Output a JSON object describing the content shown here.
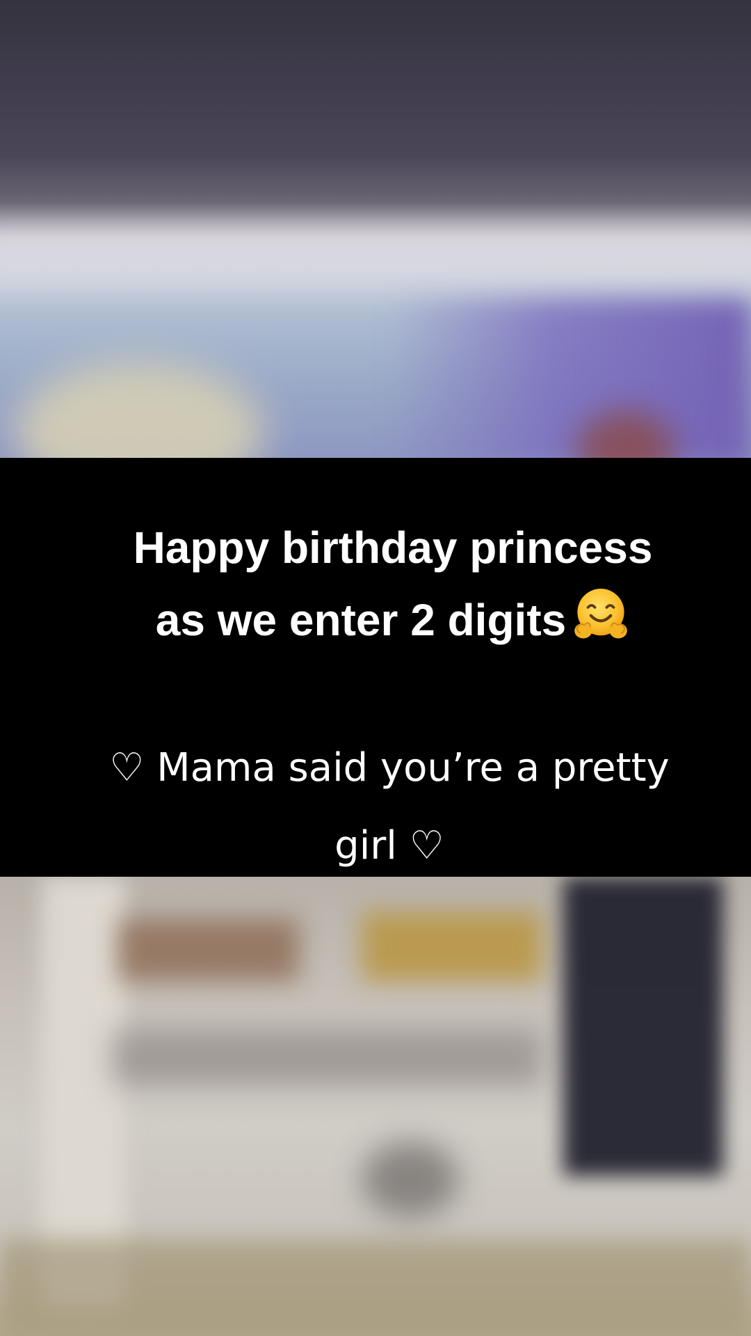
{
  "caption": {
    "headline_line1": "Happy birthday princess",
    "headline_line2": "as we enter 2 digits",
    "headline_emoji": "🤗",
    "subline_line1": "♡ Mama said you’re a pretty",
    "subline_line2": "girl ♡"
  },
  "icons": {
    "emoji": "hugging-face-icon"
  }
}
